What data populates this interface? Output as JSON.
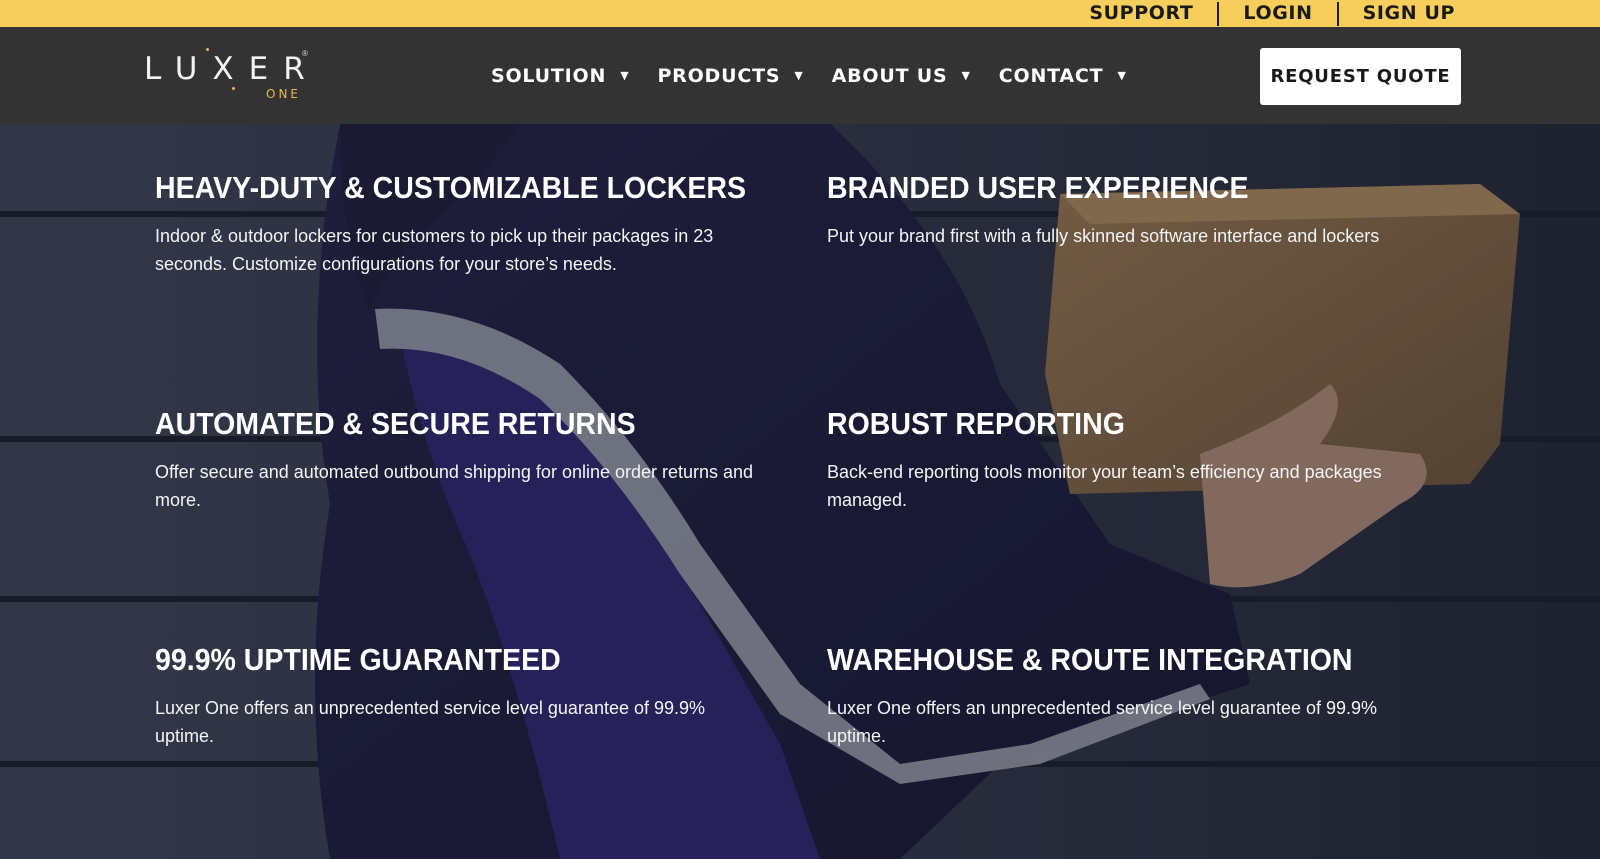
{
  "topbar": {
    "links": [
      "SUPPORT",
      "LOGIN",
      "SIGN UP"
    ],
    "color": "#f7cd5b"
  },
  "nav": {
    "logo_word": "LUXER",
    "logo_sub": "ONE",
    "menu": [
      "SOLUTION",
      "PRODUCTS",
      "ABOUT US",
      "CONTACT"
    ],
    "caret_icon": "caret-down-icon",
    "cta": "REQUEST QUOTE",
    "background": "#333333"
  },
  "features": [
    {
      "title": "HEAVY-DUTY & CUSTOMIZABLE LOCKERS",
      "body": "Indoor & outdoor lockers for customers to pick up their packages in 23 seconds. Customize configurations for your store’s needs."
    },
    {
      "title": "BRANDED USER EXPERIENCE",
      "body": "Put your brand first with a fully skinned software interface and lockers"
    },
    {
      "title": "AUTOMATED & SECURE RETURNS",
      "body": "Offer secure and automated outbound shipping for online order returns and more."
    },
    {
      "title": "ROBUST REPORTING",
      "body": "Back-end reporting tools monitor your team’s efficiency and packages managed."
    },
    {
      "title": "99.9% UPTIME GUARANTEED",
      "body": "Luxer One offers an unprecedented service level guarantee of 99.9% uptime."
    },
    {
      "title": "WAREHOUSE & ROUTE INTEGRATION",
      "body": "Luxer One offers an unprecedented service level guarantee of 99.9% uptime."
    }
  ]
}
